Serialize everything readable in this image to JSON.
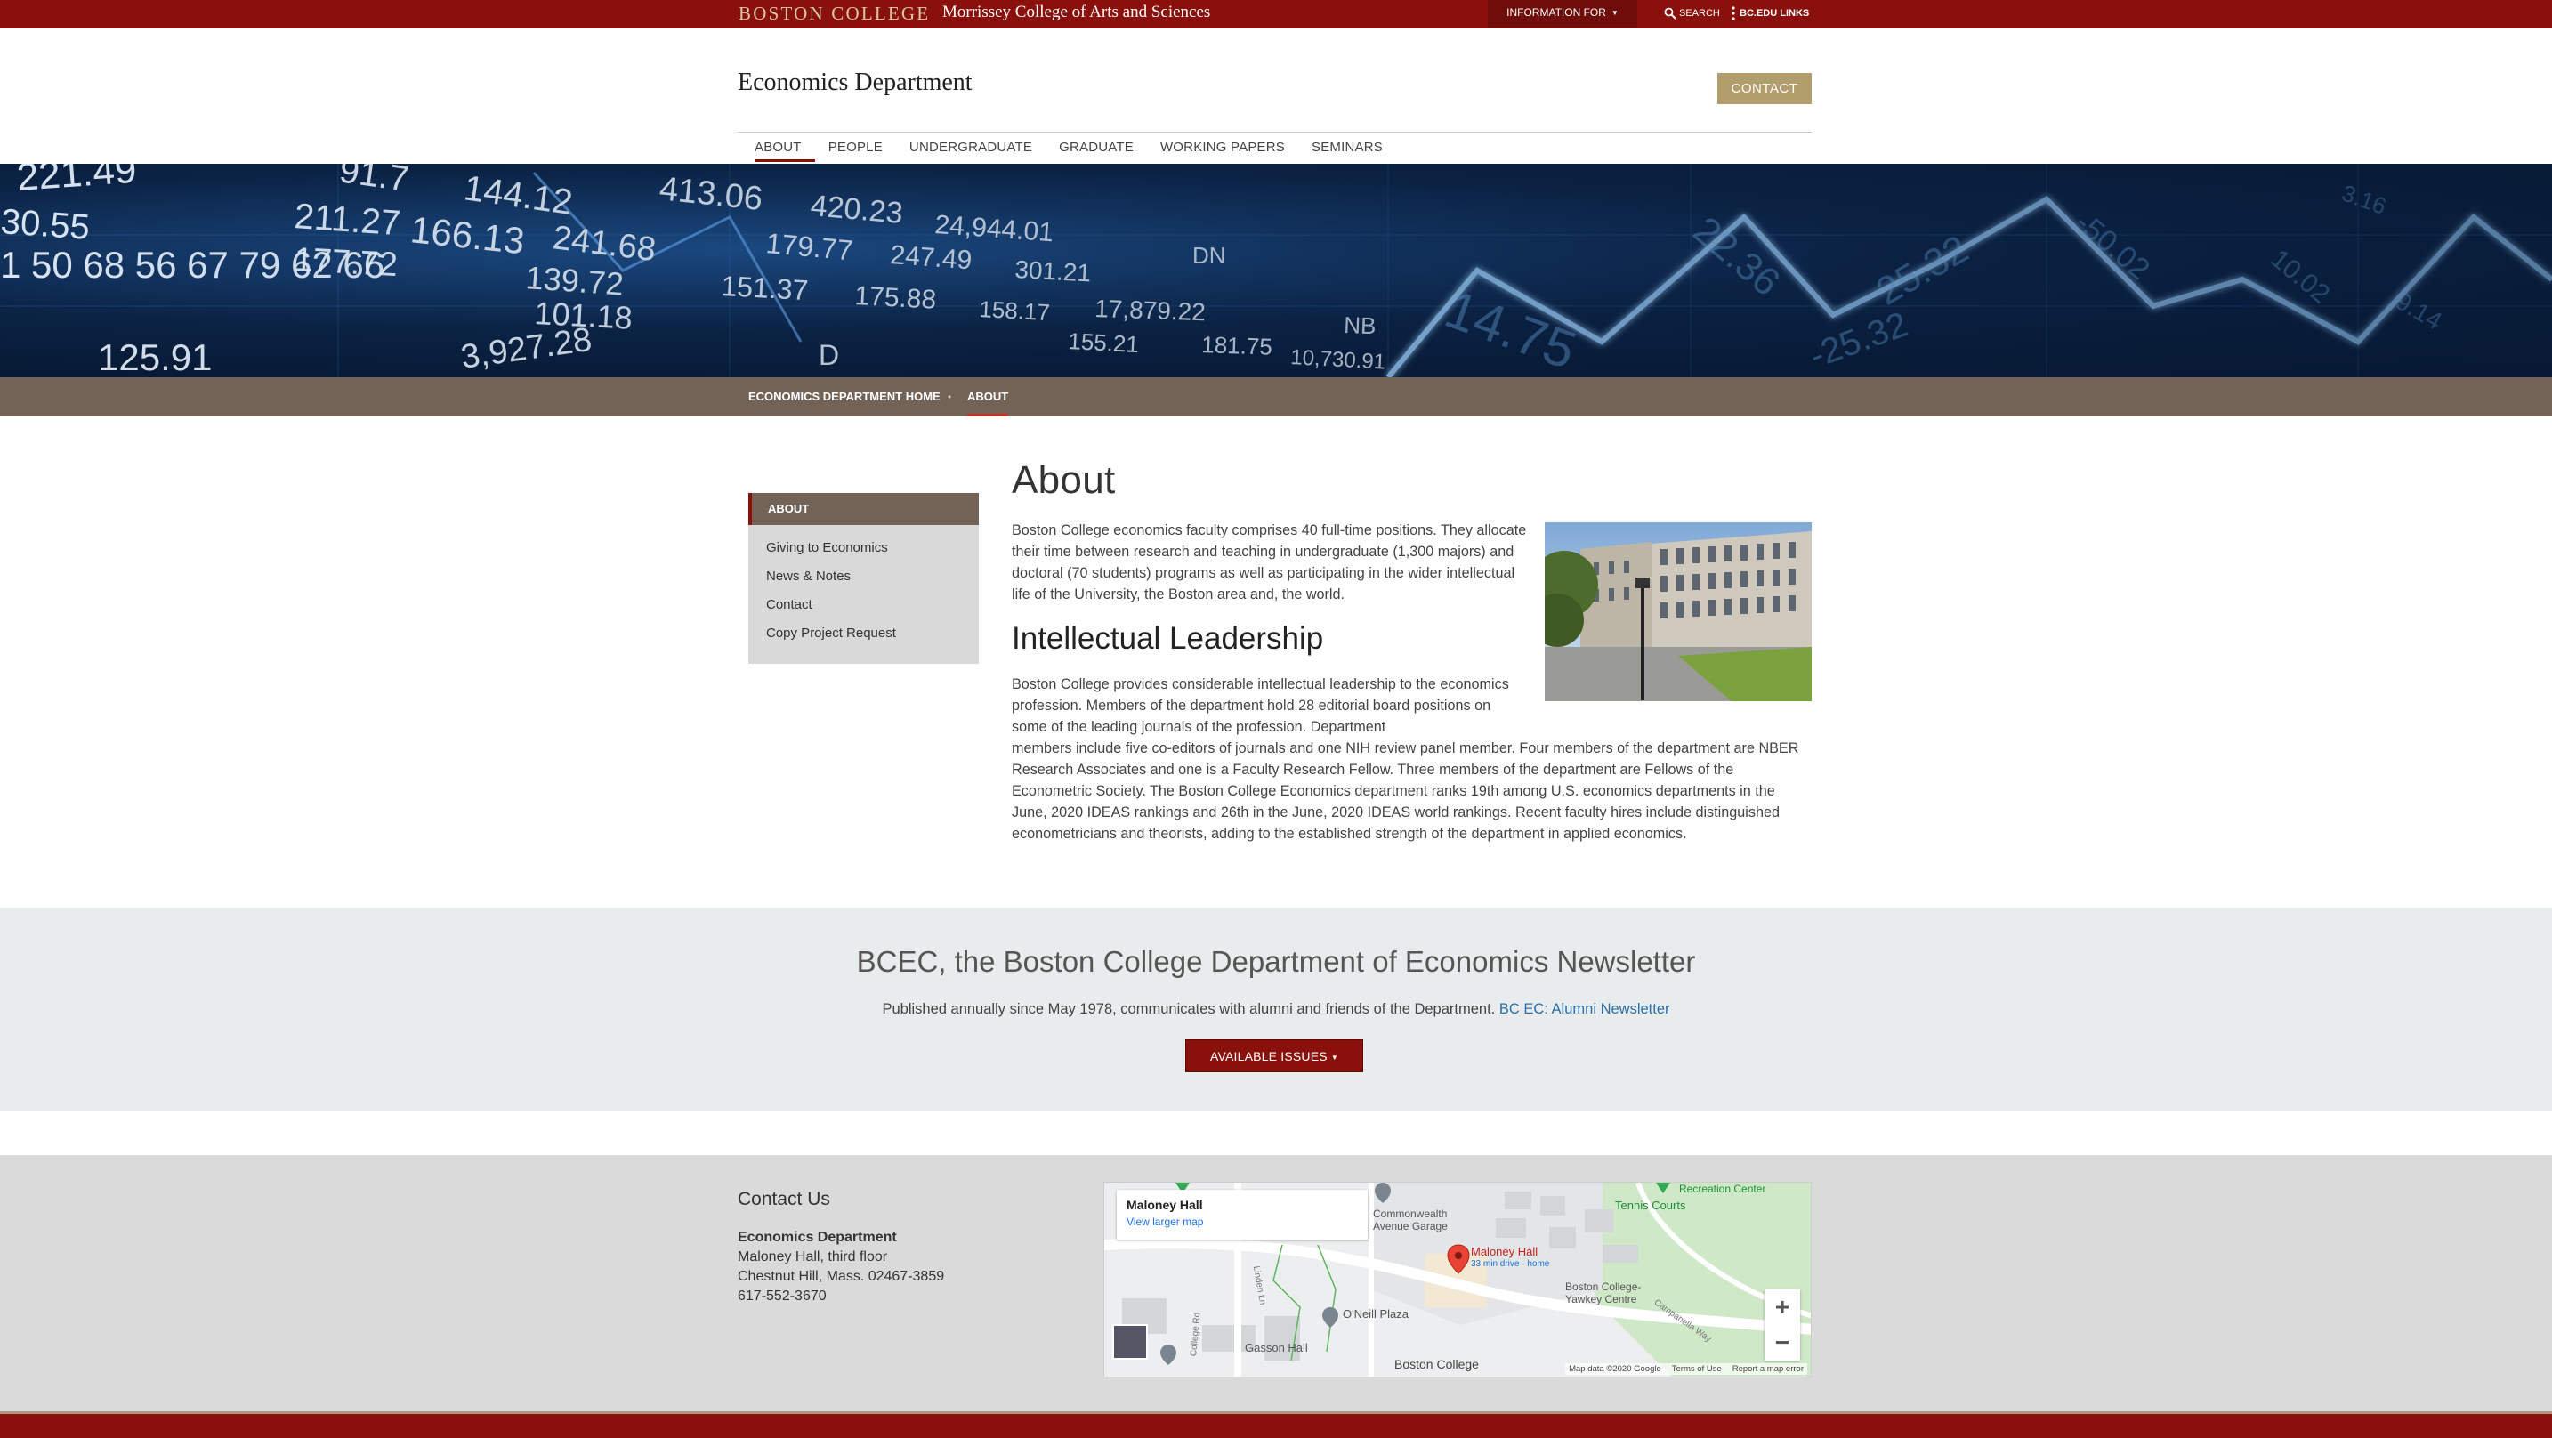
{
  "topbar": {
    "brand": "BOSTON COLLEGE",
    "school": "Morrissey College of Arts and Sciences",
    "info_for": "INFORMATION FOR",
    "search": "SEARCH",
    "bc_links": "BC.EDU LINKS"
  },
  "header": {
    "title": "Economics Department",
    "contact": "CONTACT"
  },
  "nav": {
    "items": [
      {
        "label": "ABOUT",
        "active": true
      },
      {
        "label": "PEOPLE"
      },
      {
        "label": "UNDERGRADUATE"
      },
      {
        "label": "GRADUATE"
      },
      {
        "label": "WORKING PAPERS"
      },
      {
        "label": "SEMINARS"
      }
    ]
  },
  "hero": {
    "numbers": [
      "221.49",
      "91.7",
      "144.12",
      "413.06",
      "420.23",
      "24,944.01",
      "30.55",
      "211.27",
      "166.13",
      "241.68",
      "179.77",
      "247.49",
      "301.21",
      "DN",
      "1 50 68 56 67 79 62 66",
      "177.72",
      "139.72",
      "151.37",
      "175.88",
      "158.17",
      "17,879.22",
      "101.18",
      "155.21",
      "181.75",
      "NB",
      "3,927.28",
      "10,730.91",
      "125.91",
      "D",
      "22.36",
      "25.32",
      "-50.02",
      "10.02",
      "14.75",
      "3.16",
      "-25.32",
      "9.14"
    ]
  },
  "breadcrumb": {
    "home": "ECONOMICS DEPARTMENT HOME",
    "current": "ABOUT"
  },
  "sidebar": {
    "heading": "ABOUT",
    "items": [
      "Giving to Economics",
      "News & Notes",
      "Contact",
      "Copy Project Request"
    ]
  },
  "main": {
    "heading": "About",
    "intro": "Boston College economics faculty comprises 40 full-time positions. They allocate their time between research and teaching in undergraduate (1,300 majors) and doctoral (70 students) programs as well as participating in the wider intellectual life of the University, the Boston area and, the world.",
    "subheading": "Intellectual Leadership",
    "body_a": "Boston College provides considerable intellectual leadership to the economics profession. Members of the department hold 28 editorial board positions on some of the leading journals of the profession. Department",
    "body_b": "members include five co-editors of journals and one NIH review panel member. Four members of the department are NBER Research Associates and one is a Faculty Research Fellow. Three members of the department are Fellows of the Econometric Society. The Boston College Economics department ranks 19th among U.S. economics departments in the June, 2020 IDEAS rankings and 26th in the June, 2020 IDEAS world rankings. Recent faculty hires include distinguished econometricians and theorists, adding to the established strength of the department in applied economics."
  },
  "newsletter": {
    "heading": "BCEC, the Boston College Department of Economics Newsletter",
    "text": "Published annually since May 1978, communicates with alumni and friends of the Department.",
    "link": "BC EC: Alumni Newsletter",
    "button": "AVAILABLE ISSUES"
  },
  "footer": {
    "heading": "Contact Us",
    "dept": "Economics Department",
    "line1": "Maloney Hall, third floor",
    "line2": "Chestnut Hill, Mass. 02467-3859",
    "phone": "617-552-3670"
  },
  "map": {
    "place": "Maloney Hall",
    "view_larger": "View larger map",
    "pin_label": "Maloney Hall",
    "pin_sub": "33 min drive · home",
    "labels": [
      "Recreation Center",
      "Tennis Courts",
      "Commonwealth Avenue Garage",
      "Boston College-Yawkey Centre",
      "O'Neill Plaza",
      "Gasson Hall",
      "Boston College",
      "Linden Ln",
      "College Rd",
      "Campanella Way"
    ],
    "attribution": [
      "Map data ©2020 Google",
      "Terms of Use",
      "Report a map error"
    ],
    "zoom_in": "+",
    "zoom_out": "−"
  }
}
